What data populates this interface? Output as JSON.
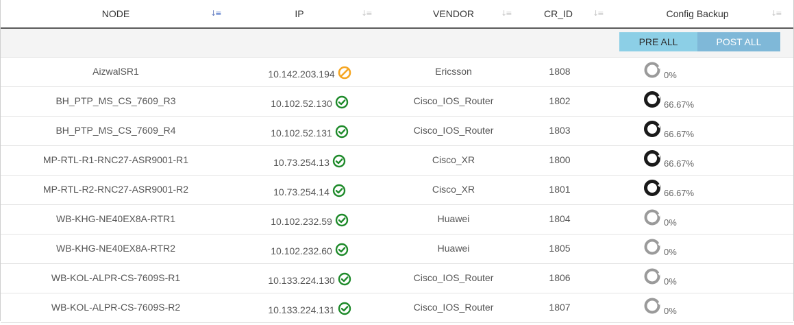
{
  "columns": [
    {
      "label": "NODE",
      "sort": "active"
    },
    {
      "label": "IP",
      "sort": "none"
    },
    {
      "label": "VENDOR",
      "sort": "none"
    },
    {
      "label": "CR_ID",
      "sort": "none"
    },
    {
      "label": "Config Backup",
      "sort": "none"
    }
  ],
  "actions": {
    "pre_all": "PRE ALL",
    "post_all": "POST ALL"
  },
  "colors": {
    "ok": "#1e8a2a",
    "blocked": "#f5a623",
    "ring_dark": "#1a1a1a",
    "ring_light": "#9a9a9a"
  },
  "rows": [
    {
      "node": "AizwalSR1",
      "ip": "10.142.203.194",
      "status": "blocked",
      "vendor": "Ericsson",
      "cr_id": "1808",
      "backup": "0%",
      "backup_value": 0
    },
    {
      "node": "BH_PTP_MS_CS_7609_R3",
      "ip": "10.102.52.130",
      "status": "ok",
      "vendor": "Cisco_IOS_Router",
      "cr_id": "1802",
      "backup": "66.67%",
      "backup_value": 66.67
    },
    {
      "node": "BH_PTP_MS_CS_7609_R4",
      "ip": "10.102.52.131",
      "status": "ok",
      "vendor": "Cisco_IOS_Router",
      "cr_id": "1803",
      "backup": "66.67%",
      "backup_value": 66.67
    },
    {
      "node": "MP-RTL-R1-RNC27-ASR9001-R1",
      "ip": "10.73.254.13",
      "status": "ok",
      "vendor": "Cisco_XR",
      "cr_id": "1800",
      "backup": "66.67%",
      "backup_value": 66.67
    },
    {
      "node": "MP-RTL-R2-RNC27-ASR9001-R2",
      "ip": "10.73.254.14",
      "status": "ok",
      "vendor": "Cisco_XR",
      "cr_id": "1801",
      "backup": "66.67%",
      "backup_value": 66.67
    },
    {
      "node": "WB-KHG-NE40EX8A-RTR1",
      "ip": "10.102.232.59",
      "status": "ok",
      "vendor": "Huawei",
      "cr_id": "1804",
      "backup": "0%",
      "backup_value": 0
    },
    {
      "node": "WB-KHG-NE40EX8A-RTR2",
      "ip": "10.102.232.60",
      "status": "ok",
      "vendor": "Huawei",
      "cr_id": "1805",
      "backup": "0%",
      "backup_value": 0
    },
    {
      "node": "WB-KOL-ALPR-CS-7609S-R1",
      "ip": "10.133.224.130",
      "status": "ok",
      "vendor": "Cisco_IOS_Router",
      "cr_id": "1806",
      "backup": "0%",
      "backup_value": 0
    },
    {
      "node": "WB-KOL-ALPR-CS-7609S-R2",
      "ip": "10.133.224.131",
      "status": "ok",
      "vendor": "Cisco_IOS_Router",
      "cr_id": "1807",
      "backup": "0%",
      "backup_value": 0
    }
  ]
}
